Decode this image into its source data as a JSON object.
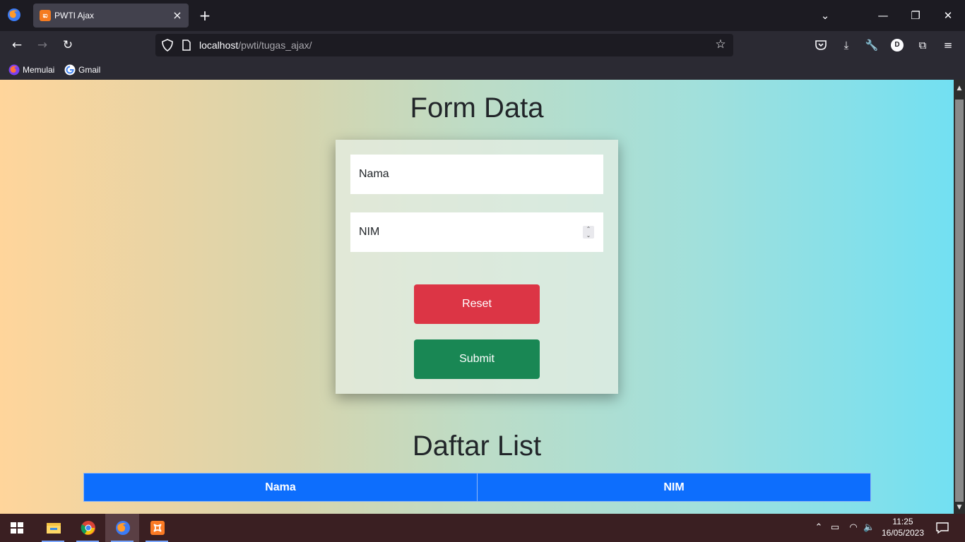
{
  "browser": {
    "tab": {
      "title": "PWTI Ajax",
      "favicon": "xampp-icon"
    },
    "url": {
      "host": "localhost",
      "path": "/pwti/tugas_ajax/"
    },
    "bookmarks": [
      {
        "label": "Memulai",
        "icon": "firefox-icon"
      },
      {
        "label": "Gmail",
        "icon": "google-icon"
      }
    ],
    "profile_initial": "D"
  },
  "page": {
    "form_title": "Form Data",
    "nama_placeholder": "Nama",
    "nim_placeholder": "NIM",
    "reset_label": "Reset",
    "submit_label": "Submit",
    "list_title": "Daftar List",
    "table_headers": [
      "Nama",
      "NIM"
    ]
  },
  "taskbar": {
    "time": "11:25",
    "date": "16/05/2023",
    "apps": [
      "file-explorer-icon",
      "chrome-icon",
      "firefox-icon",
      "xampp-icon"
    ]
  },
  "colors": {
    "reset": "#dc3545",
    "submit": "#198754",
    "table_header": "#0d6efd"
  }
}
